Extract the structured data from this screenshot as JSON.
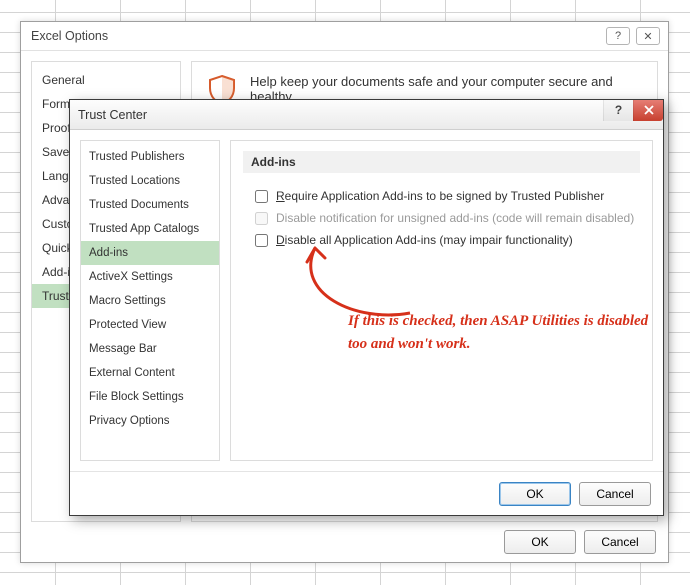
{
  "excel_options": {
    "title": "Excel Options",
    "nav": [
      "General",
      "Formulas",
      "Proofing",
      "Save",
      "Language",
      "Advanced",
      "Customize Ribbon",
      "Quick Access Toolbar",
      "Add-ins",
      "Trust Center"
    ],
    "nav_selected_index": 9,
    "banner": "Help keep your documents safe and your computer secure and healthy.",
    "ok": "OK",
    "cancel": "Cancel"
  },
  "trust_center": {
    "title": "Trust Center",
    "nav": [
      "Trusted Publishers",
      "Trusted Locations",
      "Trusted Documents",
      "Trusted App Catalogs",
      "Add-ins",
      "ActiveX Settings",
      "Macro Settings",
      "Protected View",
      "Message Bar",
      "External Content",
      "File Block Settings",
      "Privacy Options"
    ],
    "nav_selected_index": 4,
    "section_header": "Add-ins",
    "opt1_prefix": "R",
    "opt1_rest": "equire Application Add-ins to be signed by Trusted Publisher",
    "opt2": "Disable notification for unsigned add-ins (code will remain disabled)",
    "opt3_prefix": "D",
    "opt3_rest": "isable all Application Add-ins (may impair functionality)",
    "ok": "OK",
    "cancel": "Cancel"
  },
  "annotation": {
    "text": "If this is checked, then ASAP Utilities is disabled too and won't work."
  }
}
